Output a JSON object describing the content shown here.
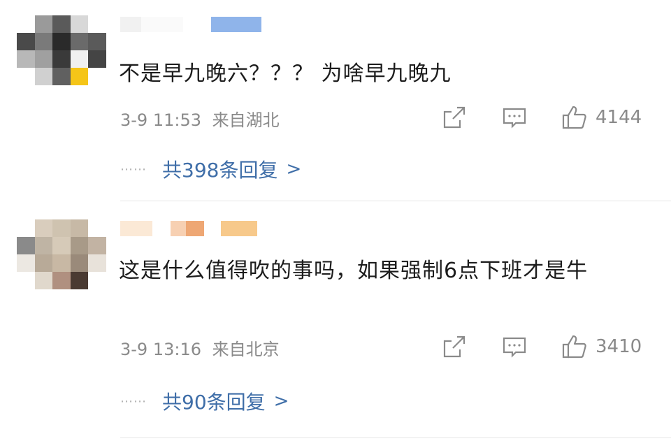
{
  "comments": [
    {
      "text": "不是早九晚六？？？ 为啥早九晚九",
      "time": "3-9 11:53",
      "location": "来自湖北",
      "likes": "4144",
      "replies_label": "共398条回复",
      "reply_chevron": ">"
    },
    {
      "text": "这是什么值得吹的事吗，如果强制6点下班才是牛",
      "time": "3-9 13:16",
      "location": "来自北京",
      "likes": "3410",
      "replies_label": "共90条回复",
      "reply_chevron": ">"
    }
  ],
  "dots": "⋯⋯",
  "colors": {
    "link": "#3f6ea8",
    "meta": "#8a8a8a",
    "text": "#1c1c1c"
  },
  "icons": [
    "share-icon",
    "comment-icon",
    "thumbs-up-icon"
  ]
}
